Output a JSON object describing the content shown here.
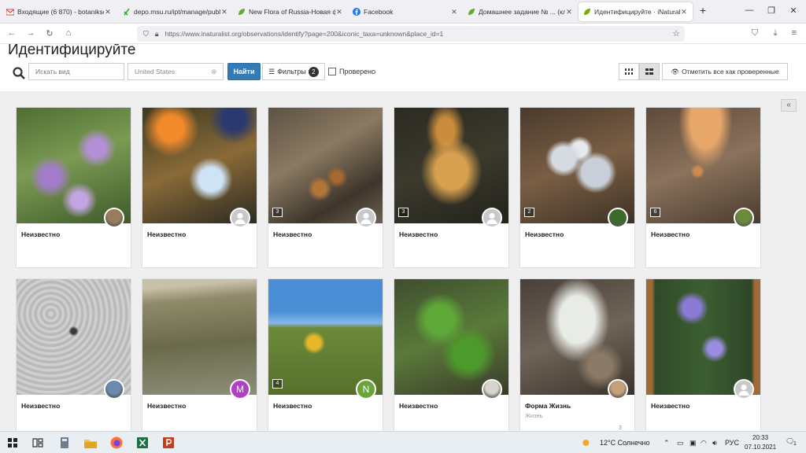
{
  "browser": {
    "tabs": [
      {
        "title": "Входящие (6 870) - botanikse",
        "icon": "gmail-icon",
        "active": false
      },
      {
        "title": "depo.msu.ru/ipt/manage/publ",
        "icon": "depo-icon",
        "active": false
      },
      {
        "title": "New Flora of Russia-Новая фл",
        "icon": "leaf-icon",
        "active": false
      },
      {
        "title": "Facebook",
        "icon": "facebook-icon",
        "active": false
      },
      {
        "title": "Домашнее задание № ... (кле",
        "icon": "leaf-icon",
        "active": false
      },
      {
        "title": "Идентифицируйте · iNaturalist",
        "icon": "inaturalist-icon",
        "active": true
      }
    ],
    "new_tab": "+",
    "url": "https://www.inaturalist.org/observations/identify?page=200&iconic_taxa=unknown&place_id=1"
  },
  "page": {
    "title": "Идентифицируйте",
    "search_placeholder": "Искать вид",
    "place_value": "United States",
    "find_label": "Найти",
    "filters_label": "Фильтры",
    "filters_count": "2",
    "reviewed_label": "Проверено",
    "mark_all_label": "Отметить все как проверенные",
    "collapse": "«"
  },
  "observations": [
    {
      "name": "Неизвестно",
      "common": "",
      "photos": "",
      "avatar": "photo",
      "ids": ""
    },
    {
      "name": "Неизвестно",
      "common": "",
      "photos": "",
      "avatar": "default",
      "ids": ""
    },
    {
      "name": "Неизвестно",
      "common": "",
      "photos": "3",
      "avatar": "default",
      "ids": ""
    },
    {
      "name": "Неизвестно",
      "common": "",
      "photos": "3",
      "avatar": "default",
      "ids": ""
    },
    {
      "name": "Неизвестно",
      "common": "",
      "photos": "2",
      "avatar": "photo",
      "ids": ""
    },
    {
      "name": "Неизвестно",
      "common": "",
      "photos": "6",
      "avatar": "photo",
      "ids": ""
    },
    {
      "name": "Неизвестно",
      "common": "",
      "photos": "",
      "avatar": "photo",
      "ids": ""
    },
    {
      "name": "Неизвестно",
      "common": "",
      "photos": "",
      "avatar": "letter",
      "letter": "M",
      "ids": ""
    },
    {
      "name": "Неизвестно",
      "common": "",
      "photos": "4",
      "avatar": "letter",
      "letter": "N",
      "ids": ""
    },
    {
      "name": "Неизвестно",
      "common": "",
      "photos": "",
      "avatar": "photo",
      "ids": ""
    },
    {
      "name": "Форма Жизнь",
      "common": "Жизнь",
      "photos": "",
      "avatar": "photo",
      "ids": "3"
    },
    {
      "name": "Неизвестно",
      "common": "",
      "photos": "",
      "avatar": "default",
      "ids": ""
    }
  ],
  "taskbar": {
    "weather": "12°C  Солнечно",
    "lang": "РУС",
    "time": "20:33",
    "date": "07.10.2021",
    "notifications": "1"
  },
  "colors": {
    "accent": "#337ab7",
    "inat_green": "#74ac00"
  }
}
